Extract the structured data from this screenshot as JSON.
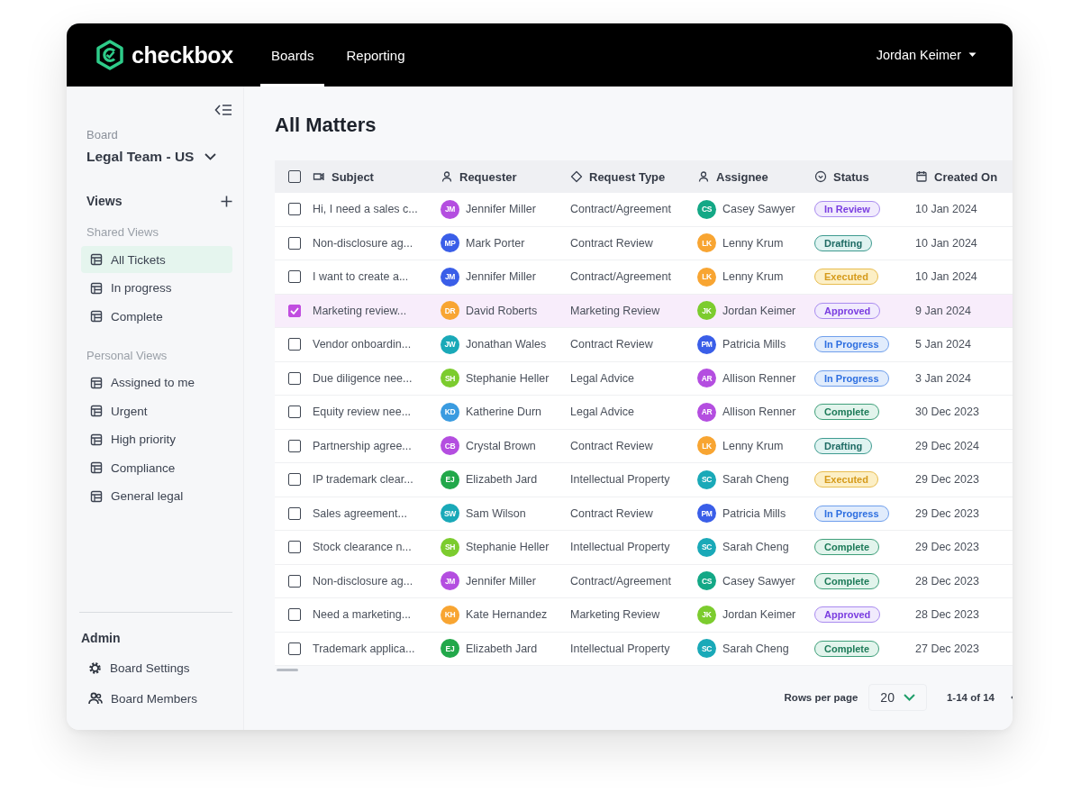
{
  "topbar": {
    "logo": "checkbox",
    "tabs": [
      {
        "label": "Boards",
        "selected": true
      },
      {
        "label": "Reporting",
        "selected": false
      }
    ],
    "user": "Jordan Keimer"
  },
  "sidebar": {
    "board_label": "Board",
    "board": "Legal Team - US",
    "views_title": "Views",
    "groups": [
      {
        "title": "Shared Views",
        "items": [
          {
            "label": "All Tickets",
            "selected": true
          },
          {
            "label": "In progress",
            "selected": false
          },
          {
            "label": "Complete",
            "selected": false
          }
        ]
      },
      {
        "title": "Personal Views",
        "items": [
          {
            "label": "Assigned to me",
            "selected": false
          },
          {
            "label": "Urgent",
            "selected": false
          },
          {
            "label": "High priority",
            "selected": false
          },
          {
            "label": "Compliance",
            "selected": false
          },
          {
            "label": "General legal",
            "selected": false
          }
        ]
      }
    ],
    "admin_title": "Admin",
    "admin_items": [
      "Board Settings",
      "Board Members"
    ]
  },
  "page_title": "All Matters",
  "table": {
    "all_checked": false,
    "columns": [
      "Subject",
      "Requester",
      "Request Type",
      "Assignee",
      "Status",
      "Created On"
    ],
    "rows": [
      {
        "checked": false,
        "subject": "Hi, I need a sales c...",
        "requester": {
          "initials": "JM",
          "name": "Jennifer Miller",
          "color": "#b44ee0"
        },
        "type": "Contract/Agreement",
        "assignee": {
          "initials": "CS",
          "name": "Casey Sawyer",
          "color": "#14a886"
        },
        "status": {
          "label": "In Review",
          "kind": "review"
        },
        "created": "10 Jan 2024"
      },
      {
        "checked": false,
        "subject": "Non-disclosure ag...",
        "requester": {
          "initials": "MP",
          "name": "Mark Porter",
          "color": "#3a5ee8"
        },
        "type": "Contract Review",
        "assignee": {
          "initials": "LK",
          "name": "Lenny Krum",
          "color": "#f8a532"
        },
        "status": {
          "label": "Drafting",
          "kind": "drafting"
        },
        "created": "10 Jan 2024"
      },
      {
        "checked": false,
        "subject": "I want to create a...",
        "requester": {
          "initials": "JM",
          "name": "Jennifer Miller",
          "color": "#3a5ee8"
        },
        "type": "Contract/Agreement",
        "assignee": {
          "initials": "LK",
          "name": "Lenny Krum",
          "color": "#f8a532"
        },
        "status": {
          "label": "Executed",
          "kind": "executed"
        },
        "created": "10 Jan 2024"
      },
      {
        "checked": true,
        "subject": "Marketing review...",
        "requester": {
          "initials": "DR",
          "name": "David Roberts",
          "color": "#f8a532"
        },
        "type": "Marketing Review",
        "assignee": {
          "initials": "JK",
          "name": "Jordan Keimer",
          "color": "#7ccc2e"
        },
        "status": {
          "label": "Approved",
          "kind": "approved"
        },
        "created": "9 Jan 2024"
      },
      {
        "checked": false,
        "subject": "Vendor onboardin...",
        "requester": {
          "initials": "JW",
          "name": "Jonathan Wales",
          "color": "#1aa9b8"
        },
        "type": "Contract Review",
        "assignee": {
          "initials": "PM",
          "name": "Patricia Mills",
          "color": "#3a5ee8"
        },
        "status": {
          "label": "In Progress",
          "kind": "progress"
        },
        "created": "5 Jan 2024"
      },
      {
        "checked": false,
        "subject": "Due diligence nee...",
        "requester": {
          "initials": "SH",
          "name": "Stephanie Heller",
          "color": "#7ccc2e"
        },
        "type": "Legal Advice",
        "assignee": {
          "initials": "AR",
          "name": "Allison Renner",
          "color": "#b44ee0"
        },
        "status": {
          "label": "In Progress",
          "kind": "progress"
        },
        "created": "3 Jan 2024"
      },
      {
        "checked": false,
        "subject": "Equity review nee...",
        "requester": {
          "initials": "KD",
          "name": "Katherine Durn",
          "color": "#3a9be0"
        },
        "type": "Legal Advice",
        "assignee": {
          "initials": "AR",
          "name": "Allison Renner",
          "color": "#b44ee0"
        },
        "status": {
          "label": "Complete",
          "kind": "complete"
        },
        "created": "30 Dec 2023"
      },
      {
        "checked": false,
        "subject": "Partnership agree...",
        "requester": {
          "initials": "CB",
          "name": "Crystal Brown",
          "color": "#b44ee0"
        },
        "type": "Contract Review",
        "assignee": {
          "initials": "LK",
          "name": "Lenny Krum",
          "color": "#f8a532"
        },
        "status": {
          "label": "Drafting",
          "kind": "drafting"
        },
        "created": "29 Dec 2024"
      },
      {
        "checked": false,
        "subject": "IP trademark clear...",
        "requester": {
          "initials": "EJ",
          "name": "Elizabeth Jard",
          "color": "#22a84a"
        },
        "type": "Intellectual Property",
        "assignee": {
          "initials": "SC",
          "name": "Sarah Cheng",
          "color": "#1aa9b8"
        },
        "status": {
          "label": "Executed",
          "kind": "executed"
        },
        "created": "29 Dec 2023"
      },
      {
        "checked": false,
        "subject": "Sales agreement...",
        "requester": {
          "initials": "SW",
          "name": "Sam Wilson",
          "color": "#1aa9b8"
        },
        "type": "Contract Review",
        "assignee": {
          "initials": "PM",
          "name": "Patricia Mills",
          "color": "#3a5ee8"
        },
        "status": {
          "label": "In Progress",
          "kind": "progress"
        },
        "created": "29 Dec 2023"
      },
      {
        "checked": false,
        "subject": "Stock clearance n...",
        "requester": {
          "initials": "SH",
          "name": "Stephanie Heller",
          "color": "#7ccc2e"
        },
        "type": "Intellectual Property",
        "assignee": {
          "initials": "SC",
          "name": "Sarah Cheng",
          "color": "#1aa9b8"
        },
        "status": {
          "label": "Complete",
          "kind": "complete"
        },
        "created": "29 Dec 2023"
      },
      {
        "checked": false,
        "subject": "Non-disclosure ag...",
        "requester": {
          "initials": "JM",
          "name": "Jennifer Miller",
          "color": "#b44ee0"
        },
        "type": "Contract/Agreement",
        "assignee": {
          "initials": "CS",
          "name": "Casey Sawyer",
          "color": "#14a886"
        },
        "status": {
          "label": "Complete",
          "kind": "complete"
        },
        "created": "28 Dec 2023"
      },
      {
        "checked": false,
        "subject": "Need a marketing...",
        "requester": {
          "initials": "KH",
          "name": "Kate Hernandez",
          "color": "#f8a532"
        },
        "type": "Marketing Review",
        "assignee": {
          "initials": "JK",
          "name": "Jordan Keimer",
          "color": "#7ccc2e"
        },
        "status": {
          "label": "Approved",
          "kind": "approved"
        },
        "created": "28 Dec 2023"
      },
      {
        "checked": false,
        "subject": "Trademark applica...",
        "requester": {
          "initials": "EJ",
          "name": "Elizabeth Jard",
          "color": "#22a84a"
        },
        "type": "Intellectual Property",
        "assignee": {
          "initials": "SC",
          "name": "Sarah Cheng",
          "color": "#1aa9b8"
        },
        "status": {
          "label": "Complete",
          "kind": "complete"
        },
        "created": "27 Dec 2023"
      }
    ]
  },
  "pagination": {
    "rows_label": "Rows per page",
    "rows_value": "20",
    "range": "1-14 of 14"
  }
}
